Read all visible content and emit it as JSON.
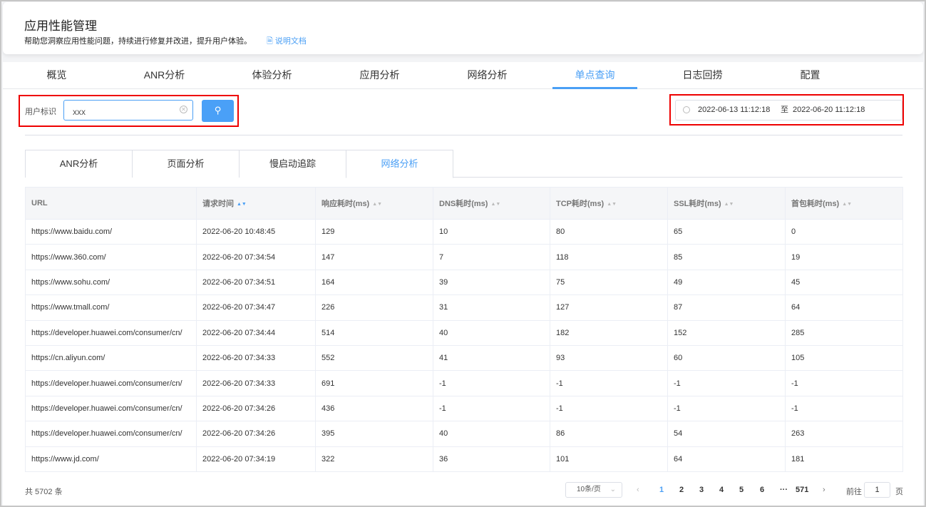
{
  "header": {
    "title": "应用性能管理",
    "subtitle": "帮助您洞察应用性能问题，持续进行修复并改进，提升用户体验。",
    "doc_link": "说明文档"
  },
  "tabs": [
    "概览",
    "ANR分析",
    "体验分析",
    "应用分析",
    "网络分析",
    "单点查询",
    "日志回捞",
    "配置"
  ],
  "active_tab": 5,
  "search": {
    "label": "用户标识",
    "value": "xxx"
  },
  "date_range": {
    "start": "2022-06-13 11:12:18",
    "sep": "至",
    "end": "2022-06-20 11:12:18"
  },
  "subtabs": [
    "ANR分析",
    "页面分析",
    "慢启动追踪",
    "网络分析"
  ],
  "active_subtab": 3,
  "table": {
    "columns": [
      "URL",
      "请求时间",
      "响应耗时(ms)",
      "DNS耗时(ms)",
      "TCP耗时(ms)",
      "SSL耗时(ms)",
      "首包耗时(ms)"
    ],
    "rows": [
      [
        "https://www.baidu.com/",
        "2022-06-20 10:48:45",
        "129",
        "10",
        "80",
        "65",
        "0"
      ],
      [
        "https://www.360.com/",
        "2022-06-20 07:34:54",
        "147",
        "7",
        "118",
        "85",
        "19"
      ],
      [
        "https://www.sohu.com/",
        "2022-06-20 07:34:51",
        "164",
        "39",
        "75",
        "49",
        "45"
      ],
      [
        "https://www.tmall.com/",
        "2022-06-20 07:34:47",
        "226",
        "31",
        "127",
        "87",
        "64"
      ],
      [
        "https://developer.huawei.com/consumer/cn/",
        "2022-06-20 07:34:44",
        "514",
        "40",
        "182",
        "152",
        "285"
      ],
      [
        "https://cn.aliyun.com/",
        "2022-06-20 07:34:33",
        "552",
        "41",
        "93",
        "60",
        "105"
      ],
      [
        "https://developer.huawei.com/consumer/cn/",
        "2022-06-20 07:34:33",
        "691",
        "-1",
        "-1",
        "-1",
        "-1"
      ],
      [
        "https://developer.huawei.com/consumer/cn/",
        "2022-06-20 07:34:26",
        "436",
        "-1",
        "-1",
        "-1",
        "-1"
      ],
      [
        "https://developer.huawei.com/consumer/cn/",
        "2022-06-20 07:34:26",
        "395",
        "40",
        "86",
        "54",
        "263"
      ],
      [
        "https://www.jd.com/",
        "2022-06-20 07:34:19",
        "322",
        "36",
        "101",
        "64",
        "181"
      ]
    ]
  },
  "pagination": {
    "total": "共 5702 条",
    "page_size": "10条/页",
    "pages": [
      "1",
      "2",
      "3",
      "4",
      "5",
      "6",
      "···",
      "571"
    ],
    "current": "1",
    "goto_label": "前往",
    "goto_value": "1",
    "page_unit": "页"
  }
}
